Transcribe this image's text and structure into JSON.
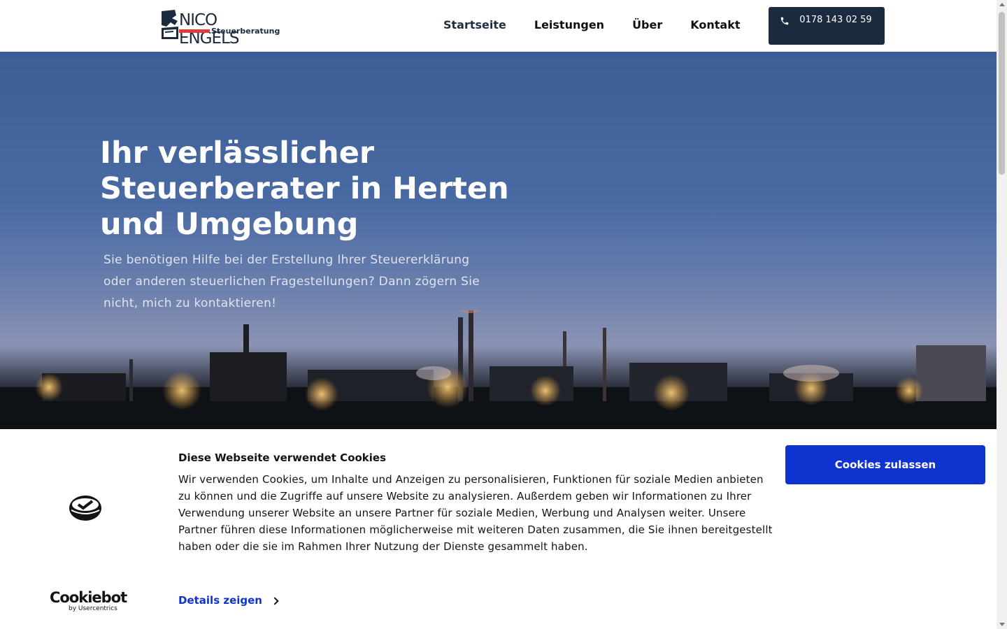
{
  "header": {
    "logo": {
      "main": "NICO ENGELS",
      "sub": "Steuerberatung",
      "icon": "logo-mark-icon"
    },
    "nav": [
      {
        "label": "Startseite",
        "active": true
      },
      {
        "label": "Leistungen",
        "active": false
      },
      {
        "label": "Über",
        "active": false
      },
      {
        "label": "Kontakt",
        "active": false
      }
    ],
    "phone": {
      "icon": "phone-icon",
      "label": "0178 143 02 59"
    }
  },
  "hero": {
    "title": "Ihr verlässlicher Steuerberater in Herten und Umgebung",
    "text": "Sie benötigen Hilfe bei der Erstellung Ihrer Steuererklärung oder anderen steuerlichen Fragestellungen? Dann zögern Sie nicht, mich zu kontaktieren!",
    "image": "industrial-skyline-at-dusk"
  },
  "cookie_banner": {
    "title": "Diese Webseite verwendet Cookies",
    "body": "Wir verwenden Cookies, um Inhalte und Anzeigen zu personalisieren, Funktionen für soziale Medien anbieten zu können und die Zugriffe auf unsere Website zu analysieren. Außerdem geben wir Informationen zu Ihrer Verwendung unserer Website an unsere Partner für soziale Medien, Werbung und Analysen weiter. Unsere Partner führen diese Informationen möglicherweise mit weiteren Daten zusammen, die Sie ihnen bereitgestellt haben oder die sie im Rahmen Ihrer Nutzung der Dienste gesammelt haben.",
    "details_label": "Details zeigen",
    "allow_label": "Cookies zulassen",
    "brand_main": "Cookiebot",
    "brand_sub": "by Usercentrics"
  },
  "colors": {
    "primary_dark": "#1b2a3f",
    "accent_red": "#e23b3b",
    "cookie_blue": "#1032cf"
  }
}
